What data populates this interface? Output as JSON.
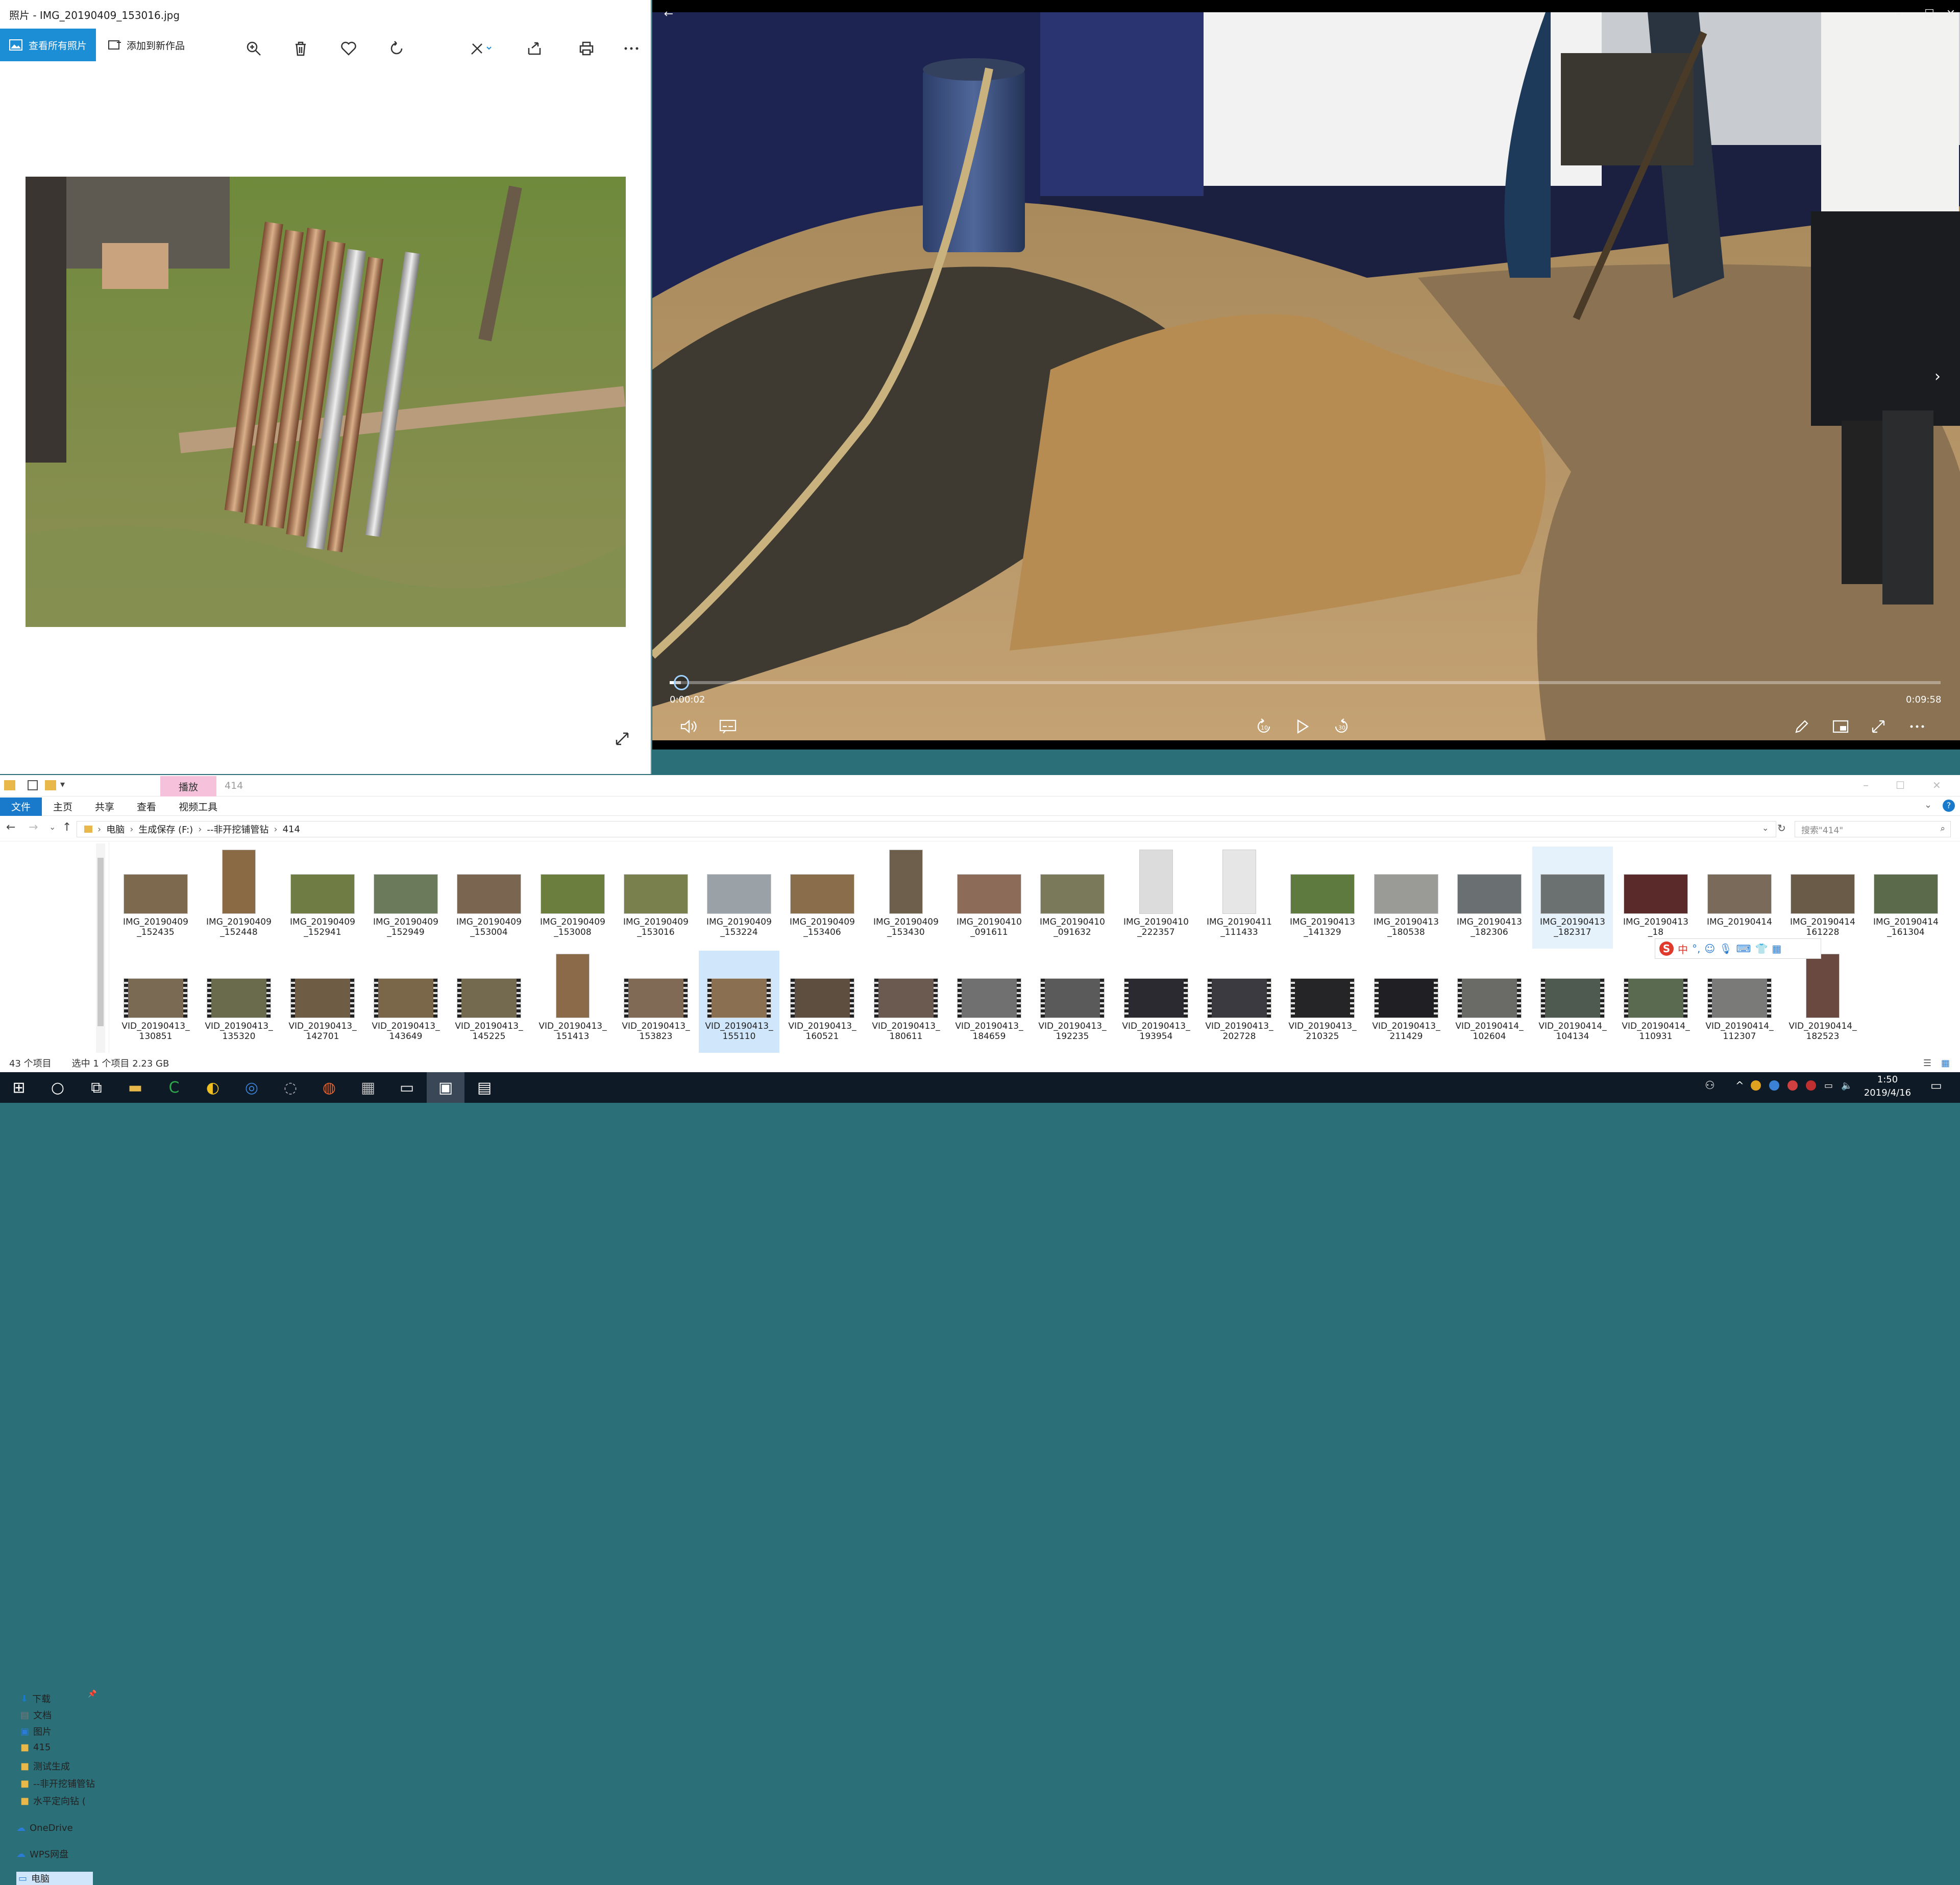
{
  "photos": {
    "window_title": "照片 - IMG_20190409_153016.jpg",
    "view_all_button": "查看所有照片",
    "add_to_creation_button": "添加到新作品",
    "toolbar_icons": [
      "zoom-in-icon",
      "trash-icon",
      "heart-icon",
      "rotate-icon",
      "edit-icon",
      "share-icon",
      "print-icon",
      "more-icon"
    ]
  },
  "player": {
    "current_time": "0:00:02",
    "total_time": "0:09:58",
    "progress_fraction": 0.0034,
    "controls": [
      "volume-icon",
      "subtitles-icon",
      "replay-10-icon",
      "play-icon",
      "forward-30-icon",
      "pen-icon",
      "mini-view-icon",
      "fullscreen-icon",
      "more-icon"
    ]
  },
  "explorer": {
    "quick_access_toolbar": "▾",
    "context_tab": "播放",
    "folder_title": "414",
    "ribbon_tabs": [
      "文件",
      "主页",
      "共享",
      "查看",
      "视频工具"
    ],
    "breadcrumb": [
      "电脑",
      "生成保存 (F:)",
      "--非开挖铺管钻",
      "414"
    ],
    "search_placeholder": "搜索\"414\"",
    "nav_items": [
      {
        "label": "下载",
        "icon": "download-icon"
      },
      {
        "label": "文档",
        "icon": "document-icon"
      },
      {
        "label": "图片",
        "icon": "pictures-icon"
      },
      {
        "label": "415",
        "icon": "folder-icon"
      },
      {
        "label": "测试生成",
        "icon": "folder-icon"
      },
      {
        "label": "--非开挖铺管钻",
        "icon": "folder-icon"
      },
      {
        "label": "水平定向钻 (",
        "icon": "folder-icon"
      },
      {
        "label": "OneDrive",
        "icon": "cloud-icon"
      },
      {
        "label": "WPS网盘",
        "icon": "cloud-icon"
      },
      {
        "label": "电脑",
        "icon": "pc-icon"
      }
    ],
    "row1": [
      {
        "l1": "IMG_20190409",
        "l2": "_152435",
        "c": "#7d6a4e"
      },
      {
        "l1": "IMG_20190409",
        "l2": "_152448",
        "c": "#8a6a44"
      },
      {
        "l1": "IMG_20190409",
        "l2": "_152941",
        "c": "#6f7d44"
      },
      {
        "l1": "IMG_20190409",
        "l2": "_152949",
        "c": "#6a7a5a"
      },
      {
        "l1": "IMG_20190409",
        "l2": "_153004",
        "c": "#7a6650"
      },
      {
        "l1": "IMG_20190409",
        "l2": "_153008",
        "c": "#6c7e3e"
      },
      {
        "l1": "IMG_20190409",
        "l2": "_153016",
        "c": "#79804d"
      },
      {
        "l1": "IMG_20190409",
        "l2": "_153224",
        "c": "#9aa2a8"
      },
      {
        "l1": "IMG_20190409",
        "l2": "_153406",
        "c": "#8a6d4a"
      },
      {
        "l1": "IMG_20190409",
        "l2": "_153430",
        "c": "#6e5e4c"
      },
      {
        "l1": "IMG_20190410",
        "l2": "_091611",
        "c": "#8c6b58"
      },
      {
        "l1": "IMG_20190410",
        "l2": "_091632",
        "c": "#7a7a5a"
      },
      {
        "l1": "IMG_20190410",
        "l2": "_222357",
        "c": "#dcdcdc"
      },
      {
        "l1": "IMG_20190411",
        "l2": "_111433",
        "c": "#e6e6e6"
      },
      {
        "l1": "IMG_20190413",
        "l2": "_141329",
        "c": "#5f7a3e"
      },
      {
        "l1": "IMG_20190413",
        "l2": "_180538",
        "c": "#9a9a96"
      },
      {
        "l1": "IMG_20190413",
        "l2": "_182306",
        "c": "#6a6f72"
      },
      {
        "l1": "IMG_20190413",
        "l2": "_182317",
        "c": "#6a7170"
      },
      {
        "l1": "IMG_20190413",
        "l2": "_18",
        "c": "#5a2a2a"
      },
      {
        "l1": "IMG_20190414",
        "l2": "",
        "c": "#7a6a5a"
      },
      {
        "l1": "IMG_20190414",
        "l2": "161228",
        "c": "#6a5a48"
      },
      {
        "l1": "IMG_20190414",
        "l2": "_161304",
        "c": "#5a6a4a"
      }
    ],
    "row2": [
      {
        "l1": "VID_20190413_",
        "l2": "130851",
        "c": "#7a6a54"
      },
      {
        "l1": "VID_20190413_",
        "l2": "135320",
        "c": "#6a6a4c"
      },
      {
        "l1": "VID_20190413_",
        "l2": "142701",
        "c": "#6e5c44"
      },
      {
        "l1": "VID_20190413_",
        "l2": "143649",
        "c": "#7a6648"
      },
      {
        "l1": "VID_20190413_",
        "l2": "145225",
        "c": "#746a50"
      },
      {
        "l1": "VID_20190413_",
        "l2": "151413",
        "c": "#8a6a48"
      },
      {
        "l1": "VID_20190413_",
        "l2": "153823",
        "c": "#806a56"
      },
      {
        "l1": "VID_20190413_",
        "l2": "155110",
        "c": "#8a7050"
      },
      {
        "l1": "VID_20190413_",
        "l2": "160521",
        "c": "#5e4e40"
      },
      {
        "l1": "VID_20190413_",
        "l2": "180611",
        "c": "#6a5a50"
      },
      {
        "l1": "VID_20190413_",
        "l2": "184659",
        "c": "#707070"
      },
      {
        "l1": "VID_20190413_",
        "l2": "192235",
        "c": "#5a5a5a"
      },
      {
        "l1": "VID_20190413_",
        "l2": "193954",
        "c": "#2a2a30"
      },
      {
        "l1": "VID_20190413_",
        "l2": "202728",
        "c": "#3a3a40"
      },
      {
        "l1": "VID_20190413_",
        "l2": "210325",
        "c": "#252528"
      },
      {
        "l1": "VID_20190413_",
        "l2": "211429",
        "c": "#202024"
      },
      {
        "l1": "VID_20190414_",
        "l2": "102604",
        "c": "#6a6a66"
      },
      {
        "l1": "VID_20190414_",
        "l2": "104134",
        "c": "#4e5a50"
      },
      {
        "l1": "VID_20190414_",
        "l2": "110931",
        "c": "#5a6a50"
      },
      {
        "l1": "VID_20190414_",
        "l2": "112307",
        "c": "#7a7a78"
      },
      {
        "l1": "VID_20190414_",
        "l2": "182523",
        "c": "#6a4a40"
      }
    ],
    "status_count": "43 个项目",
    "status_selection": "选中 1 个项目  2.23 GB"
  },
  "ime": {
    "logo": "S",
    "mode": "中"
  },
  "taskbar": {
    "time": "1:50",
    "date": "2019/4/16",
    "apps": [
      "start-icon",
      "search-icon",
      "task-view-icon",
      "file-explorer-icon",
      "camtasia-icon",
      "sogou-browser-icon",
      "qq-browser-icon",
      "other-app-icon",
      "fox-app-icon",
      "thumb-app-icon",
      "window-app-icon",
      "photos-icon",
      "movies-icon"
    ]
  },
  "colors": {
    "accent": "#1b8ed6",
    "ribbon_file": "#1979ca",
    "context_tab": "#f6c2db",
    "taskbar": "#0e1a26"
  }
}
